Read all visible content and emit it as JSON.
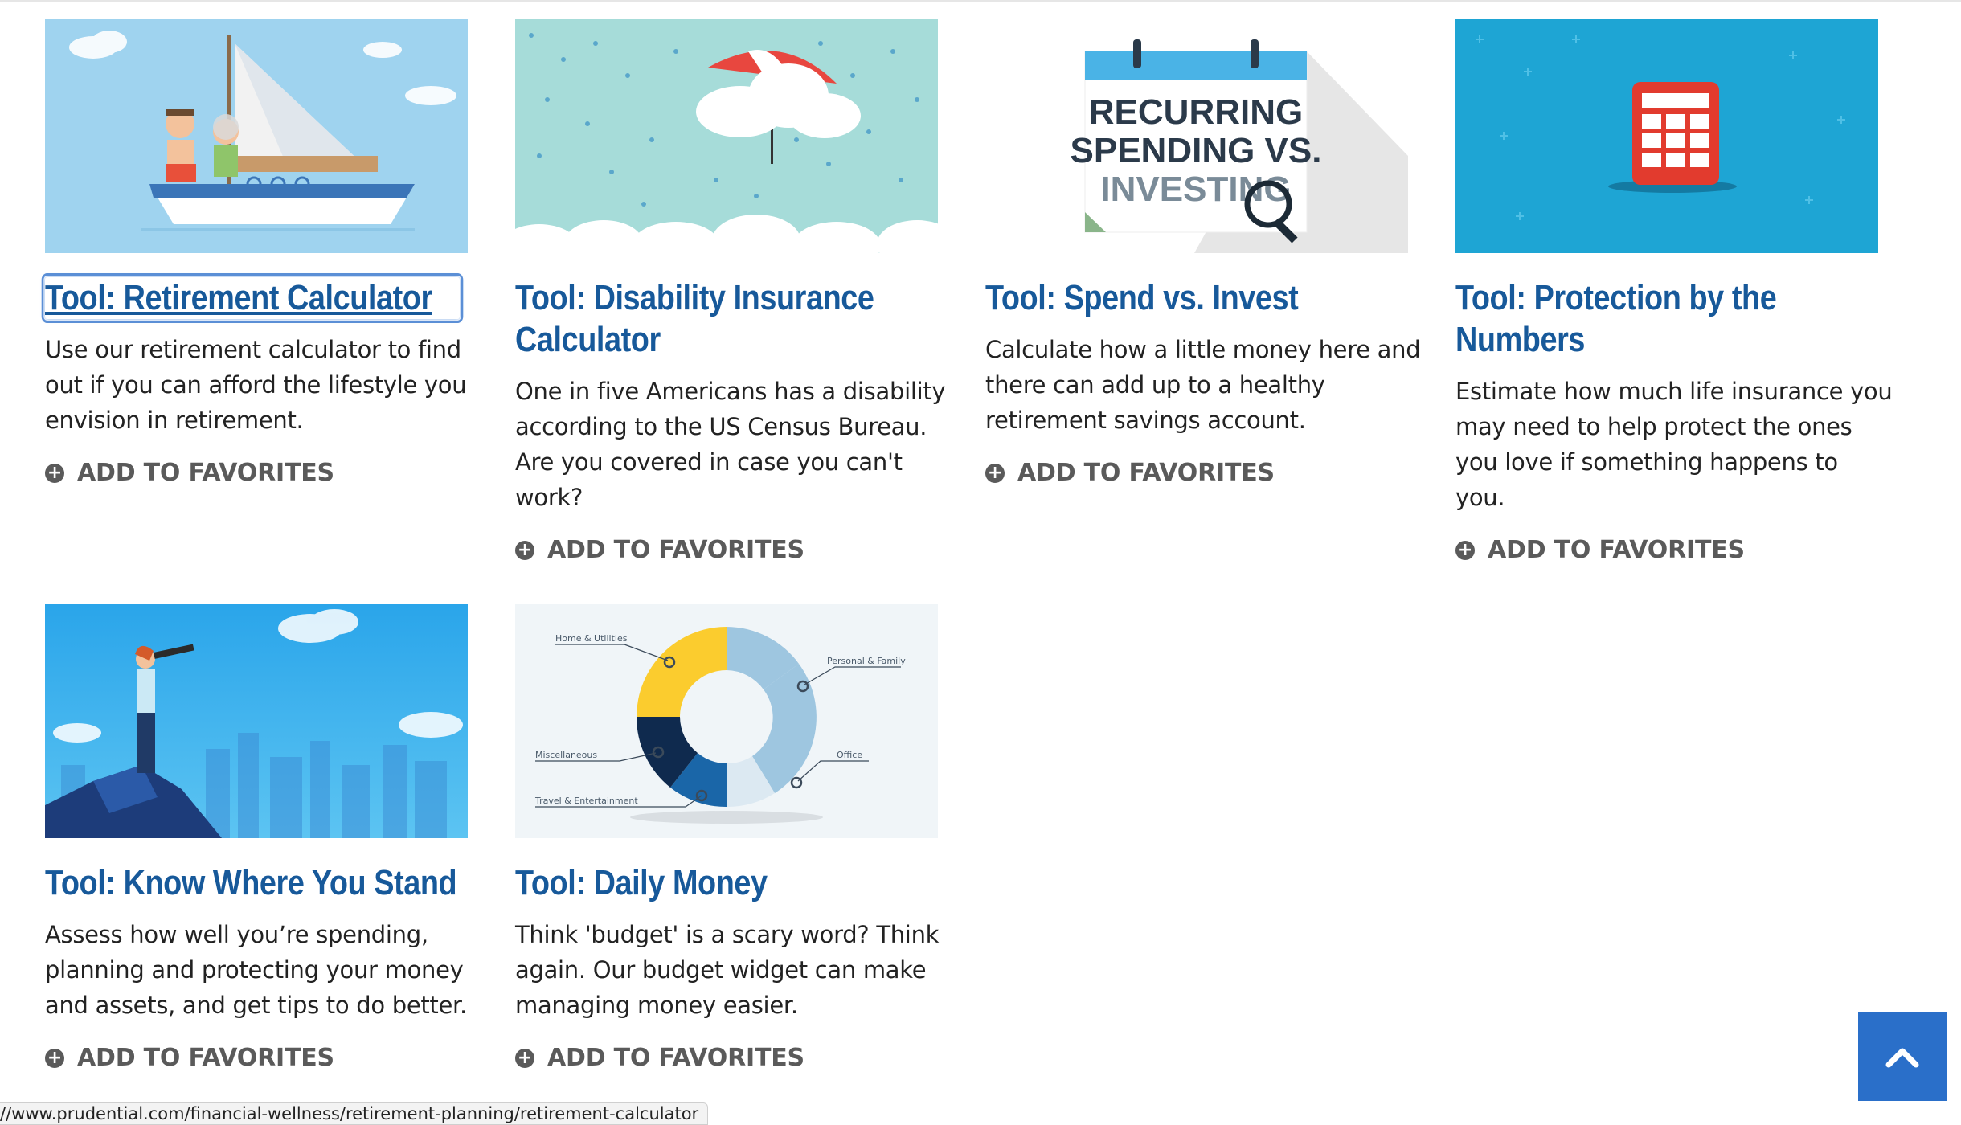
{
  "cards": [
    {
      "title": "Tool: Retirement Calculator",
      "description": "Use our retirement calculator to find out if you can afford the lifestyle you envision in retirement.",
      "favorite_label": "ADD TO FAVORITES",
      "image": "retirement-sailboat-illustration"
    },
    {
      "title": "Tool: Disability Insurance Calculator",
      "description": "One in five Americans has a disability according to the US Census Bureau. Are you covered in case you can't work?",
      "favorite_label": "ADD TO FAVORITES",
      "image": "umbrella-rain-illustration"
    },
    {
      "title": "Tool: Spend vs. Invest",
      "description": "Calculate how a little money here and there can add up to a healthy retirement savings account.",
      "favorite_label": "ADD TO FAVORITES",
      "image": "calendar-illustration",
      "image_text": [
        "RECURRING",
        "SPENDING VS.",
        "INVESTING"
      ]
    },
    {
      "title": "Tool: Protection by the Numbers",
      "description": "Estimate how much life insurance you may need to help protect the ones you love if something happens to you.",
      "favorite_label": "ADD TO FAVORITES",
      "image": "calculator-illustration"
    },
    {
      "title": "Tool: Know Where You Stand",
      "description": "Assess how well you’re spending, planning and protecting your money and assets, and get tips to do better.",
      "favorite_label": "ADD TO FAVORITES",
      "image": "woman-telescope-illustration"
    },
    {
      "title": "Tool: Daily Money",
      "description": "Think 'budget' is a scary word? Think again. Our budget widget can make managing money easier.",
      "favorite_label": "ADD TO FAVORITES",
      "image": "budget-donut-illustration",
      "image_labels": [
        "Home & Utilities",
        "Personal & Family",
        "Miscellaneous",
        "Office",
        "Travel & Entertainment"
      ]
    }
  ],
  "status_url": "//www.prudential.com/financial-wellness/retirement-planning/retirement-calculator",
  "colors": {
    "title": "#17599a",
    "scroll_top_button": "#2a6fc9"
  }
}
